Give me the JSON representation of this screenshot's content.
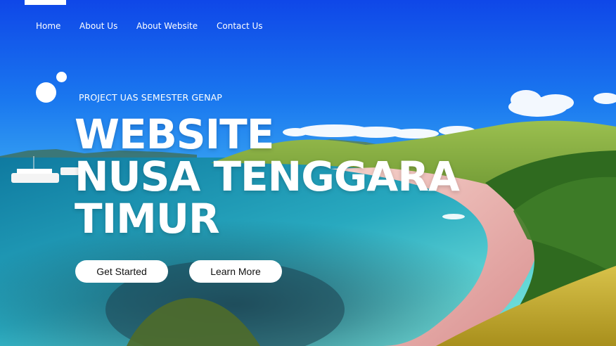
{
  "nav": {
    "items": [
      "Home",
      "About Us",
      "About Website",
      "Contact Us"
    ]
  },
  "hero": {
    "kicker": "PROJECT UAS SEMESTER GENAP",
    "headline_lines": [
      "WEBSITE",
      "NUSA TENGGARA",
      "TIMUR"
    ],
    "buttons": {
      "get_started": "Get Started",
      "learn_more": "Learn More"
    }
  },
  "colors": {
    "sky_top": "#0f49ea",
    "sky_horizon": "#1f8df3",
    "sea_deep": "#0c6f8f",
    "sea_shallow": "#5dd2d6",
    "sand": "#f1c1b9",
    "hill_green": "#82a93c",
    "white": "#ffffff"
  }
}
